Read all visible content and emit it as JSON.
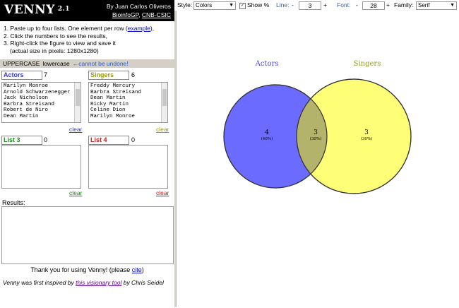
{
  "header": {
    "logo": "VENNY",
    "version": "2.1",
    "author": "By Juan Carlos Oliveros",
    "org1": "BioinfoGP",
    "org_sep": ",",
    "org2": "CNB-CSIC"
  },
  "instructions": {
    "line1_pre": "1. Paste up to four lists. One element per row (",
    "line1_link": "example",
    "line1_post": "),",
    "line2": "2. Click the numbers to see the results,",
    "line3": "3. Right-click the figure to view and save it",
    "line4": "(actual size in pixels: 1280x1280)"
  },
  "case": {
    "upper": "UPPERCASE",
    "lower": "lowercase",
    "warning": "←cannot be undone!"
  },
  "lists": [
    {
      "label": "Actors",
      "count": "7",
      "color": "#3a3ad0",
      "items": [
        "Marilyn Monroe",
        "Arnold Schwarzenegger",
        "Jack Nicholson",
        "Barbra Streisand",
        "Robert de Niro",
        "Dean Martin"
      ],
      "clear": "clear"
    },
    {
      "label": "Singers",
      "count": "6",
      "color": "#9a9a10",
      "items": [
        "Freddy Mercury",
        "Barbra Streisand",
        "Dean Martin",
        "Ricky Martin",
        "Celine Dion",
        "Marilyn Monroe"
      ],
      "clear": "clear"
    },
    {
      "label": "List 3",
      "count": "0",
      "color": "#1a8a1a",
      "clear": "clear"
    },
    {
      "label": "List 4",
      "count": "0",
      "color": "#c02020",
      "clear": "clear"
    }
  ],
  "results": {
    "label": "Results:"
  },
  "footer": {
    "thanks_pre": "Thank you for using Venny! (please ",
    "thanks_link": "cite",
    "thanks_post": ")",
    "inspired_pre": "Venny was first inspired by ",
    "inspired_link": "this visionary tool",
    "inspired_post": " by Chris Seidel"
  },
  "toolbar": {
    "style_label": "Style:",
    "style_value": "Colors",
    "show_pct_label": "Show %",
    "show_pct_checked": "✓",
    "line_label": "Line:",
    "line_minus": "-",
    "line_value": "3",
    "line_plus": "+",
    "font_label": "Font:",
    "font_minus": "-",
    "font_value": "28",
    "font_plus": "+",
    "family_label": "Family:",
    "family_value": "Serif"
  },
  "venn": {
    "set_a": {
      "label": "Actors",
      "color": "#6b6bff",
      "label_color": "#4a4ad8"
    },
    "set_b": {
      "label": "Singers",
      "color": "#ffff77",
      "label_color": "#9a9a20"
    },
    "overlap_color": "#b3b36b",
    "only_a": {
      "count": "4",
      "pct": "(40%)"
    },
    "both": {
      "count": "3",
      "pct": "(30%)"
    },
    "only_b": {
      "count": "3",
      "pct": "(30%)"
    }
  }
}
